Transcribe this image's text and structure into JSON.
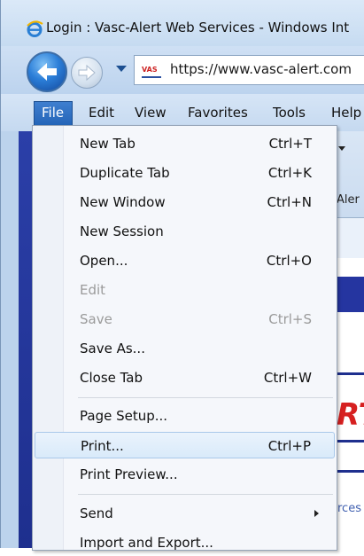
{
  "window": {
    "title": "Login : Vasc-Alert Web Services - Windows Int",
    "url": "https://www.vasc-alert.com",
    "site_icon_text": "VAS"
  },
  "menubar": {
    "items": [
      "File",
      "Edit",
      "View",
      "Favorites",
      "Tools",
      "Help"
    ]
  },
  "file_menu": {
    "items": [
      {
        "label": "New Tab",
        "shortcut": "Ctrl+T"
      },
      {
        "label": "Duplicate Tab",
        "shortcut": "Ctrl+K"
      },
      {
        "label": "New Window",
        "shortcut": "Ctrl+N"
      },
      {
        "label": "New Session",
        "shortcut": ""
      },
      {
        "label": "Open...",
        "shortcut": "Ctrl+O"
      },
      {
        "label": "Edit",
        "shortcut": "",
        "disabled": true
      },
      {
        "label": "Save",
        "shortcut": "Ctrl+S",
        "disabled": true
      },
      {
        "label": "Save As...",
        "shortcut": ""
      },
      {
        "label": "Close Tab",
        "shortcut": "Ctrl+W"
      },
      {
        "label": "Page Setup...",
        "shortcut": ""
      },
      {
        "label": "Print...",
        "shortcut": "Ctrl+P",
        "highlighted": true
      },
      {
        "label": "Print Preview...",
        "shortcut": ""
      },
      {
        "label": "Send",
        "shortcut": "",
        "submenu": true
      },
      {
        "label": "Import and Export...",
        "shortcut": ""
      }
    ]
  },
  "background_fragments": {
    "alert": "Aler",
    "s": "s",
    "rt": "RT",
    "rces": "rces"
  },
  "colors": {
    "menu_highlight": "#d9eafa",
    "file_active": "#2465b8",
    "brand_red": "#d62020",
    "brand_blue": "#1e2f8e"
  }
}
